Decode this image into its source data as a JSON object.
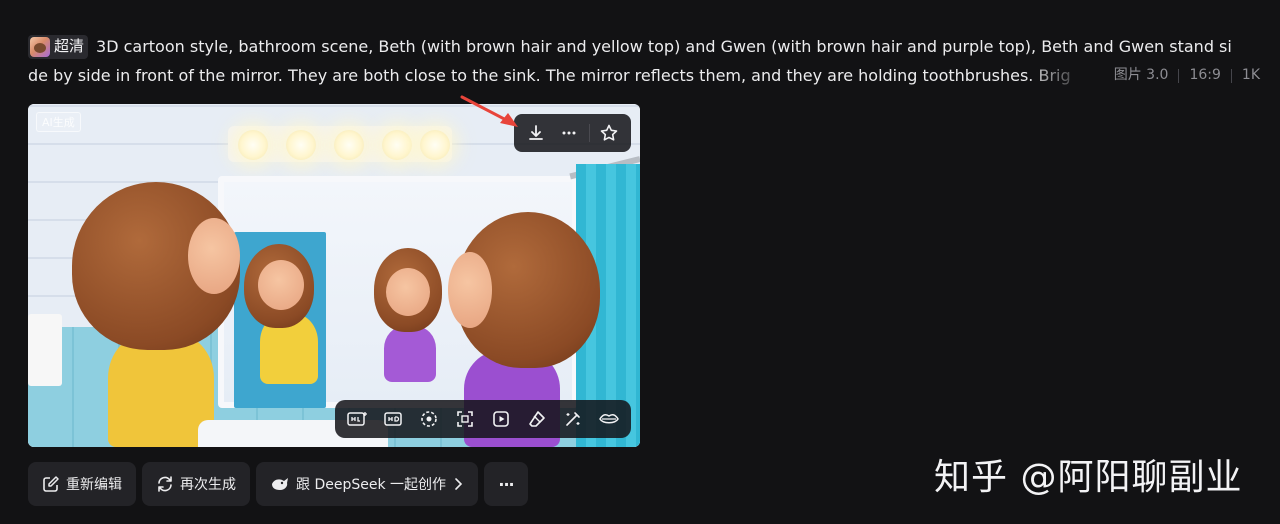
{
  "prompt": {
    "quality_label": "超清",
    "text_line1": "3D cartoon style, bathroom scene, Beth (with brown hair and yellow top) and Gwen (with brown hair and purple top), Beth and Gwen stand si",
    "text_line2": "de by side in front of the mirror. They are both close to the sink. The mirror reflects them, and they are holding toothbrushes. Brig",
    "meta": {
      "model": "图片 3.0",
      "ratio": "16:9",
      "resolution": "1K"
    }
  },
  "image": {
    "ai_badge": "AI生成",
    "top_actions": [
      {
        "name": "download-icon"
      },
      {
        "name": "more-icon"
      },
      {
        "name": "star-icon"
      }
    ],
    "tools": [
      {
        "name": "hd-plus-icon",
        "label": "HD+"
      },
      {
        "name": "hd-icon",
        "label": "HD"
      },
      {
        "name": "remix-icon"
      },
      {
        "name": "expand-icon"
      },
      {
        "name": "video-icon"
      },
      {
        "name": "eraser-icon"
      },
      {
        "name": "magic-wand-icon"
      },
      {
        "name": "lips-icon"
      }
    ]
  },
  "actions": {
    "reedit": "重新编辑",
    "regenerate": "再次生成",
    "deepseek": "跟 DeepSeek 一起创作",
    "more": "···"
  },
  "watermark": "知乎 @阿阳聊副业",
  "colors": {
    "background": "#121214",
    "accent_red": "#e0443c",
    "panel": "#232327"
  }
}
